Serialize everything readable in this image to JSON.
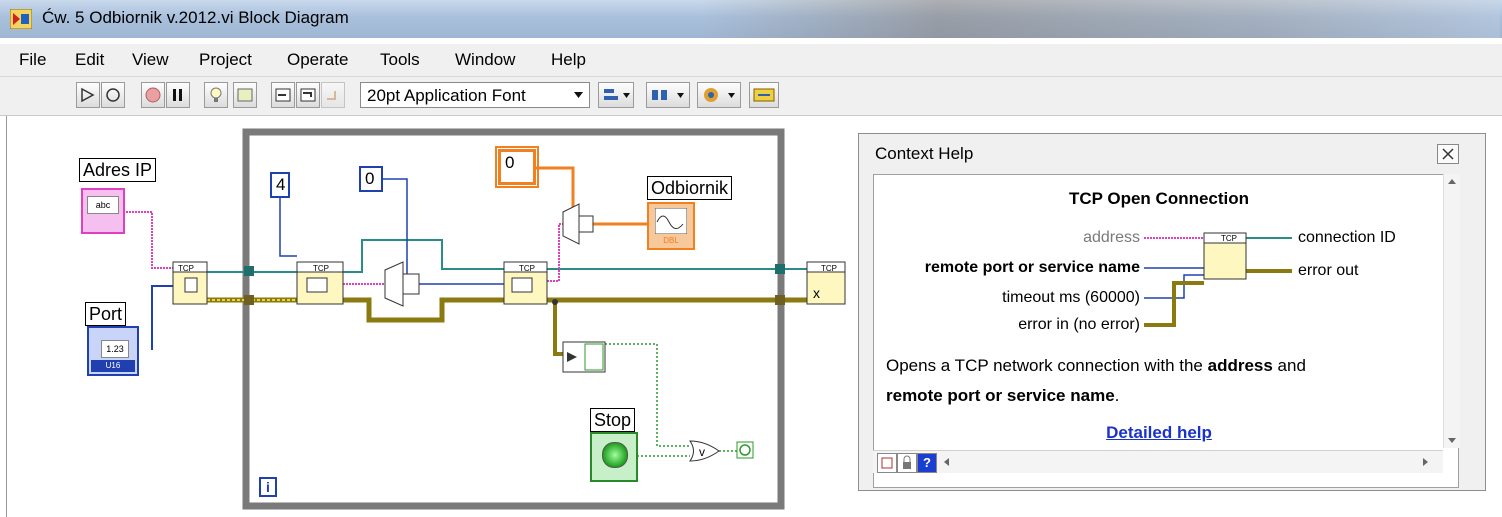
{
  "window": {
    "title": "Ćw. 5 Odbiornik v.2012.vi Block Diagram"
  },
  "menu": {
    "items": [
      "File",
      "Edit",
      "View",
      "Project",
      "Operate",
      "Tools",
      "Window",
      "Help"
    ]
  },
  "toolbar": {
    "font_selector": "20pt Application Font"
  },
  "diagram": {
    "controls": {
      "adres_ip_label": "Adres IP",
      "adres_ip_type": "abc",
      "port_label": "Port",
      "port_type": "1.23",
      "port_rep": "U16",
      "stop_label": "Stop",
      "odbiornik_label": "Odbiornik",
      "odbiornik_rep": "DBL"
    },
    "constants": {
      "c4": "4",
      "c0_blue": "0",
      "c0_orange": "0"
    },
    "loop_index": "i"
  },
  "context_help": {
    "title": "Context Help",
    "function_name": "TCP Open Connection",
    "inputs": [
      "address",
      "remote port or service name",
      "timeout ms (60000)",
      "error in (no error)"
    ],
    "outputs": [
      "connection ID",
      "error out"
    ],
    "description_prefix": "Opens a TCP network connection with the ",
    "description_bold_1": "address",
    "description_mid": " and",
    "description_bold_2": "remote port or service name",
    "description_suffix": ".",
    "detailed_help_link": "Detailed help"
  }
}
